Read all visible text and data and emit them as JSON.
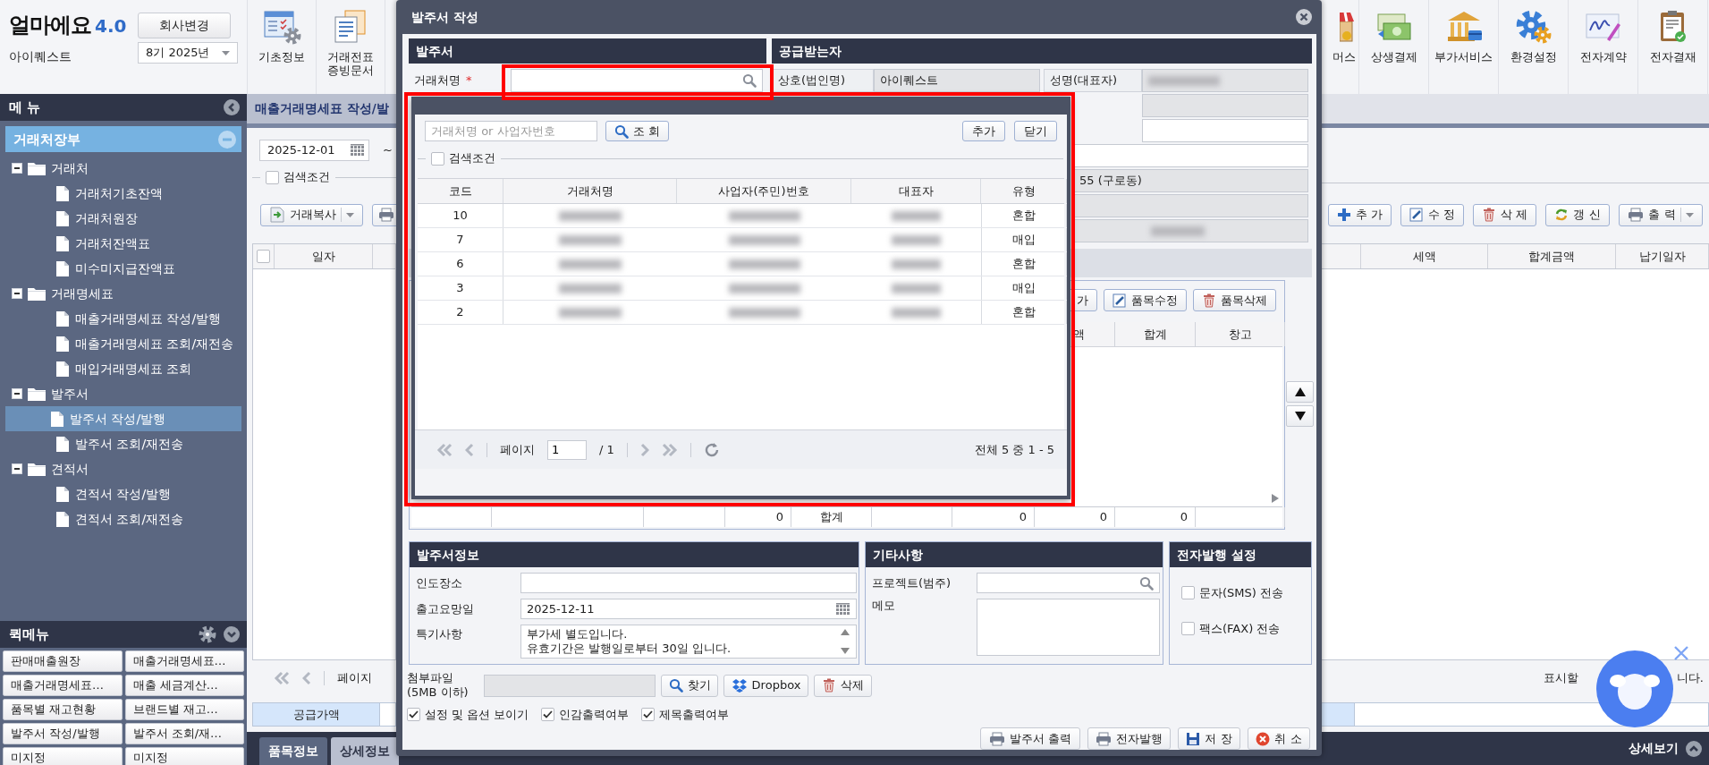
{
  "brand": {
    "logo": "얼마에요",
    "version": "4.0",
    "company": "아이퀘스트",
    "change_button": "회사변경",
    "period": "8기 2025년"
  },
  "toolbar_left": [
    {
      "lines": [
        "기초정보"
      ]
    },
    {
      "lines": [
        "거래전표",
        "증빙문서"
      ]
    }
  ],
  "toolbar_right": [
    {
      "lines": [
        "머스"
      ]
    },
    {
      "lines": [
        "상생결제"
      ]
    },
    {
      "lines": [
        "부가서비스"
      ]
    },
    {
      "lines": [
        "환경설정"
      ]
    },
    {
      "lines": [
        "전자계약"
      ]
    },
    {
      "lines": [
        "전자결재"
      ]
    }
  ],
  "sidebar": {
    "title": "메 뉴",
    "group": "거래처장부",
    "tree": [
      {
        "label": "거래처",
        "expanded": true,
        "children": [
          {
            "label": "거래처기초잔액",
            "selected": false
          },
          {
            "label": "거래처원장",
            "selected": false
          },
          {
            "label": "거래처잔액표",
            "selected": false
          },
          {
            "label": "미수미지급잔액표",
            "selected": false
          }
        ]
      },
      {
        "label": "거래명세표",
        "expanded": true,
        "children": [
          {
            "label": "매출거래명세표 작성/발행",
            "selected": false
          },
          {
            "label": "매출거래명세표 조회/재전송",
            "selected": false
          },
          {
            "label": "매입거래명세표 조회",
            "selected": false
          }
        ]
      },
      {
        "label": "발주서",
        "expanded": true,
        "children": [
          {
            "label": "발주서 작성/발행",
            "selected": true
          },
          {
            "label": "발주서 조회/재전송",
            "selected": false
          }
        ]
      },
      {
        "label": "견적서",
        "expanded": true,
        "children": [
          {
            "label": "견적서 작성/발행",
            "selected": false
          },
          {
            "label": "견적서 조회/재전송",
            "selected": false
          }
        ]
      }
    ]
  },
  "quick_menu": {
    "title": "퀵메뉴",
    "items": [
      "판매매출원장",
      "매출거래명세표…",
      "매출거래명세표…",
      "매출 세금계산…",
      "품목별 재고현황",
      "브랜드별 재고…",
      "발주서 작성/발행",
      "발주서 조회/재…",
      "미지정",
      "미지정"
    ]
  },
  "main": {
    "tab_title": "매출거래명세표 작성/발",
    "date_from": "2025-12-01",
    "range_sep": "~",
    "search_filter": {
      "label": "검색조건",
      "checked": false
    },
    "select_all_checked": false,
    "copy_button": "거래복사",
    "actions": [
      "추 가",
      "수 정",
      "삭 제",
      "갱 신",
      "출 력"
    ],
    "left_columns": [
      "일자"
    ],
    "right_columns": [
      "세액",
      "합계금액",
      "납기일자"
    ],
    "pager_label": "페이지",
    "empty_message_parts": [
      "표시할",
      "니다."
    ],
    "summary_label": "공급가액",
    "bottom_tabs": [
      {
        "label": "품목정보",
        "selected": true
      },
      {
        "label": "상세정보",
        "selected": false
      }
    ],
    "detail_toggle": "상세보기"
  },
  "dialog": {
    "title": "발주서 작성",
    "order": {
      "title": "발주서",
      "client_label": "거래처명",
      "required_mark": "*"
    },
    "supplier": {
      "title": "공급받는자",
      "name_label": "상호(법인명)",
      "name_value": "아이퀘스트",
      "ceo_label": "성명(대표자)",
      "ceo_blurred": true,
      "rows": [
        {
          "kind": "readonly",
          "wide": false
        },
        {
          "kind": "input",
          "wide": false
        },
        {
          "kind": "input",
          "wide": true
        },
        {
          "kind": "readonly",
          "wide": true,
          "value": "55 (구로동)"
        },
        {
          "kind": "readonly",
          "wide": true
        },
        {
          "kind": "readonly",
          "wide": true,
          "blurred": true
        }
      ]
    },
    "items": {
      "buttons": [
        "가",
        "품목수정",
        "품목삭제"
      ],
      "columns": [
        "액",
        "합계",
        "창고"
      ],
      "totals": [
        "0",
        "합계",
        "0",
        "0",
        "0"
      ]
    },
    "popup": {
      "search_placeholder": "거래처명 or 사업자번호",
      "search_button": "조 회",
      "add_button": "추가",
      "close_button": "닫기",
      "filter": {
        "label": "검색조건",
        "checked": false
      },
      "columns": [
        "코드",
        "거래처명",
        "사업자(주민)번호",
        "대표자",
        "유형"
      ],
      "rows": [
        {
          "code": "10",
          "type": "혼합",
          "blurred": true
        },
        {
          "code": "7",
          "type": "매입",
          "blurred": true
        },
        {
          "code": "6",
          "type": "혼합",
          "blurred": true
        },
        {
          "code": "3",
          "type": "매입",
          "blurred": true
        },
        {
          "code": "2",
          "type": "혼합",
          "blurred": true
        }
      ],
      "pager": {
        "label": "페이지",
        "page": "1",
        "total": "/ 1",
        "summary": "전체 5 중 1 - 5"
      }
    },
    "order_info": {
      "title": "발주서정보",
      "delivery_label": "인도장소",
      "due_label": "출고요망일",
      "due_value": "2025-12-11",
      "note_label": "특기사항",
      "note_lines": [
        "부가세 별도입니다.",
        "유효기간은 발행일로부터 30일 입니다."
      ]
    },
    "misc": {
      "title": "기타사항",
      "project_label": "프로젝트(범주)",
      "memo_label": "메모"
    },
    "e_issue": {
      "title": "전자발행 설정",
      "options": [
        {
          "label": "문자(SMS) 전송",
          "checked": false
        },
        {
          "label": "팩스(FAX) 전송",
          "checked": false
        }
      ]
    },
    "attachment": {
      "label_lines": [
        "첨부파일",
        "(5MB 이하)"
      ],
      "buttons": [
        "찾기",
        "Dropbox",
        "삭제"
      ]
    },
    "options": [
      {
        "label": "설정 및 옵션 보이기",
        "checked": true
      },
      {
        "label": "인감출력여부",
        "checked": true
      },
      {
        "label": "제목출력여부",
        "checked": true
      }
    ],
    "footer_buttons": [
      "발주서 출력",
      "전자발행",
      "저 장",
      "취 소"
    ]
  }
}
